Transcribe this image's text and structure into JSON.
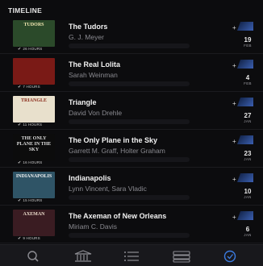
{
  "header": {
    "title": "TIMELINE"
  },
  "books": [
    {
      "title": "The Tudors",
      "author": "G. J. Meyer",
      "hours": "26 HOURS",
      "day": "19",
      "month": "FEB",
      "cover_text": "TUDORS",
      "cover_bg": "#2b4a2a",
      "cover_fg": "#f0e6b0"
    },
    {
      "title": "The Real Lolita",
      "author": "Sarah Weinman",
      "hours": "7 HOURS",
      "day": "4",
      "month": "FEB",
      "cover_text": "",
      "cover_bg": "#7a1a16",
      "cover_fg": "#ffffff"
    },
    {
      "title": "Triangle",
      "author": "David Von Drehle",
      "hours": "11 HOURS",
      "day": "27",
      "month": "JAN",
      "cover_text": "TRIANGLE",
      "cover_bg": "#e8e0cc",
      "cover_fg": "#8a2a1a"
    },
    {
      "title": "The Only Plane in the Sky",
      "author": "Garrett M. Graff, Holter Graham",
      "hours": "16 HOURS",
      "day": "23",
      "month": "JAN",
      "cover_text": "THE ONLY PLANE IN THE SKY",
      "cover_bg": "#0c0c0c",
      "cover_fg": "#dcdcdc"
    },
    {
      "title": "Indianapolis",
      "author": "Lynn Vincent, Sara Vladic",
      "hours": "15 HOURS",
      "day": "10",
      "month": "JAN",
      "cover_text": "INDIANAPOLIS",
      "cover_bg": "#2f5466",
      "cover_fg": "#f2f2f2"
    },
    {
      "title": "The Axeman of New Orleans",
      "author": "Miriam C. Davis",
      "hours": "9 HOURS",
      "day": "6",
      "month": "JAN",
      "cover_text": "AXEMAN",
      "cover_bg": "#3a1c22",
      "cover_fg": "#e8d8c8"
    }
  ],
  "tabs": [
    {
      "name": "search-tab",
      "icon": "magnifier-icon"
    },
    {
      "name": "library-tab",
      "icon": "library-icon"
    },
    {
      "name": "list-tab",
      "icon": "list-icon"
    },
    {
      "name": "stack-tab",
      "icon": "stack-icon"
    },
    {
      "name": "timeline-tab",
      "icon": "clock-icon"
    }
  ],
  "colors": {
    "accent": "#3b5eb0",
    "background": "#0c0c0e",
    "active_tab": "#3b7be0"
  }
}
